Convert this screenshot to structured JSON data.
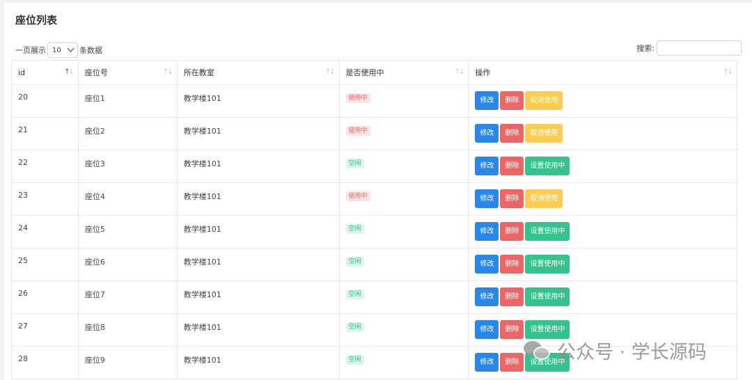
{
  "page": {
    "title": "座位列表",
    "length_prefix": "一页展示",
    "length_value": "10",
    "length_suffix": "条数据",
    "search_label": "搜索:",
    "search_value": ""
  },
  "table": {
    "columns": [
      "id",
      "座位号",
      "所在教室",
      "是否使用中",
      "操作"
    ],
    "rows": [
      {
        "id": "20",
        "seat": "座位1",
        "room": "教学楼101",
        "status": "使用中",
        "status_type": "busy",
        "action": "取消使用",
        "action_type": "cancel"
      },
      {
        "id": "21",
        "seat": "座位2",
        "room": "教学楼101",
        "status": "使用中",
        "status_type": "busy",
        "action": "取消使用",
        "action_type": "cancel"
      },
      {
        "id": "22",
        "seat": "座位3",
        "room": "教学楼101",
        "status": "空闲",
        "status_type": "free",
        "action": "设置使用中",
        "action_type": "set"
      },
      {
        "id": "23",
        "seat": "座位4",
        "room": "教学楼101",
        "status": "使用中",
        "status_type": "busy",
        "action": "取消使用",
        "action_type": "cancel"
      },
      {
        "id": "24",
        "seat": "座位5",
        "room": "教学楼101",
        "status": "空闲",
        "status_type": "free",
        "action": "设置使用中",
        "action_type": "set"
      },
      {
        "id": "25",
        "seat": "座位6",
        "room": "教学楼101",
        "status": "空闲",
        "status_type": "free",
        "action": "设置使用中",
        "action_type": "set"
      },
      {
        "id": "26",
        "seat": "座位7",
        "room": "教学楼101",
        "status": "空闲",
        "status_type": "free",
        "action": "设置使用中",
        "action_type": "set"
      },
      {
        "id": "27",
        "seat": "座位8",
        "room": "教学楼101",
        "status": "空闲",
        "status_type": "free",
        "action": "设置使用中",
        "action_type": "set"
      },
      {
        "id": "28",
        "seat": "座位9",
        "room": "教学楼101",
        "status": "空闲",
        "status_type": "free",
        "action": "设置使用中",
        "action_type": "set"
      }
    ],
    "edit_label": "修改",
    "delete_label": "删除"
  },
  "watermark": {
    "icon": "wechat-icon",
    "text": "公众号 · 学长源码"
  },
  "colors": {
    "edit": "#2a87ea",
    "delete": "#ee6565",
    "cancel": "#fccd52",
    "set": "#34c38f",
    "busy_badge": "#fde2e2",
    "free_badge": "#dcf5ec"
  }
}
